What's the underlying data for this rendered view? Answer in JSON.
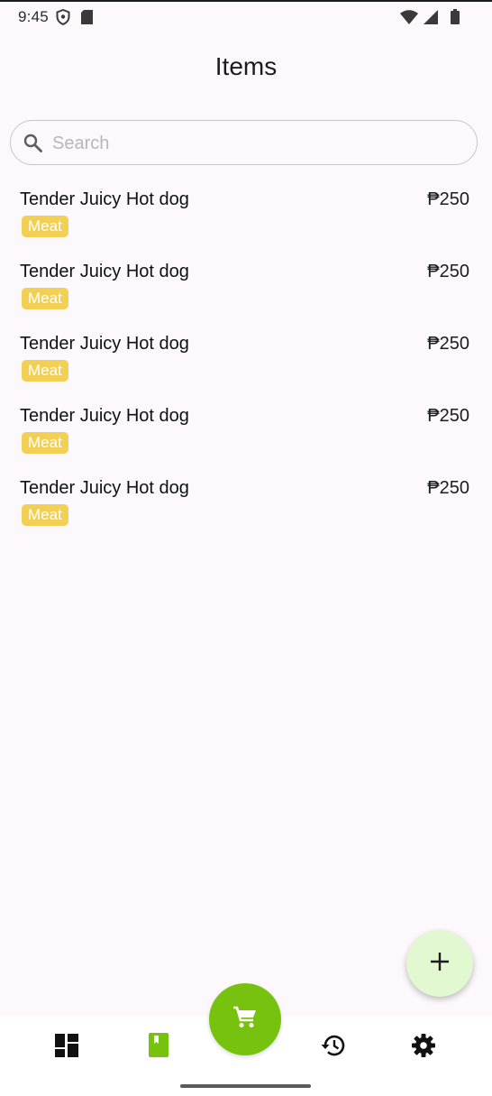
{
  "status_bar": {
    "time": "9:45",
    "icons": [
      "shield-icon",
      "sd-card-icon",
      "wifi-icon",
      "signal-icon",
      "battery-icon"
    ]
  },
  "header": {
    "title": "Items"
  },
  "search": {
    "placeholder": "Search",
    "value": ""
  },
  "items": [
    {
      "name": "Tender Juicy Hot dog",
      "category": "Meat",
      "price": "₱250"
    },
    {
      "name": "Tender Juicy Hot dog",
      "category": "Meat",
      "price": "₱250"
    },
    {
      "name": "Tender Juicy Hot dog",
      "category": "Meat",
      "price": "₱250"
    },
    {
      "name": "Tender Juicy Hot dog",
      "category": "Meat",
      "price": "₱250"
    },
    {
      "name": "Tender Juicy Hot dog",
      "category": "Meat",
      "price": "₱250"
    }
  ],
  "fab": {
    "icon": "plus-icon"
  },
  "bottom_nav": {
    "items": [
      {
        "icon": "dashboard-icon",
        "active": false
      },
      {
        "icon": "book-icon",
        "active": true
      },
      {
        "icon": "cart-icon",
        "center": true
      },
      {
        "icon": "history-icon",
        "active": false
      },
      {
        "icon": "gear-icon",
        "active": false
      }
    ]
  },
  "colors": {
    "accent": "#76c20e",
    "badge": "#f2cf55",
    "fab_background": "#e2f8d0",
    "background": "#fdf8fc"
  }
}
